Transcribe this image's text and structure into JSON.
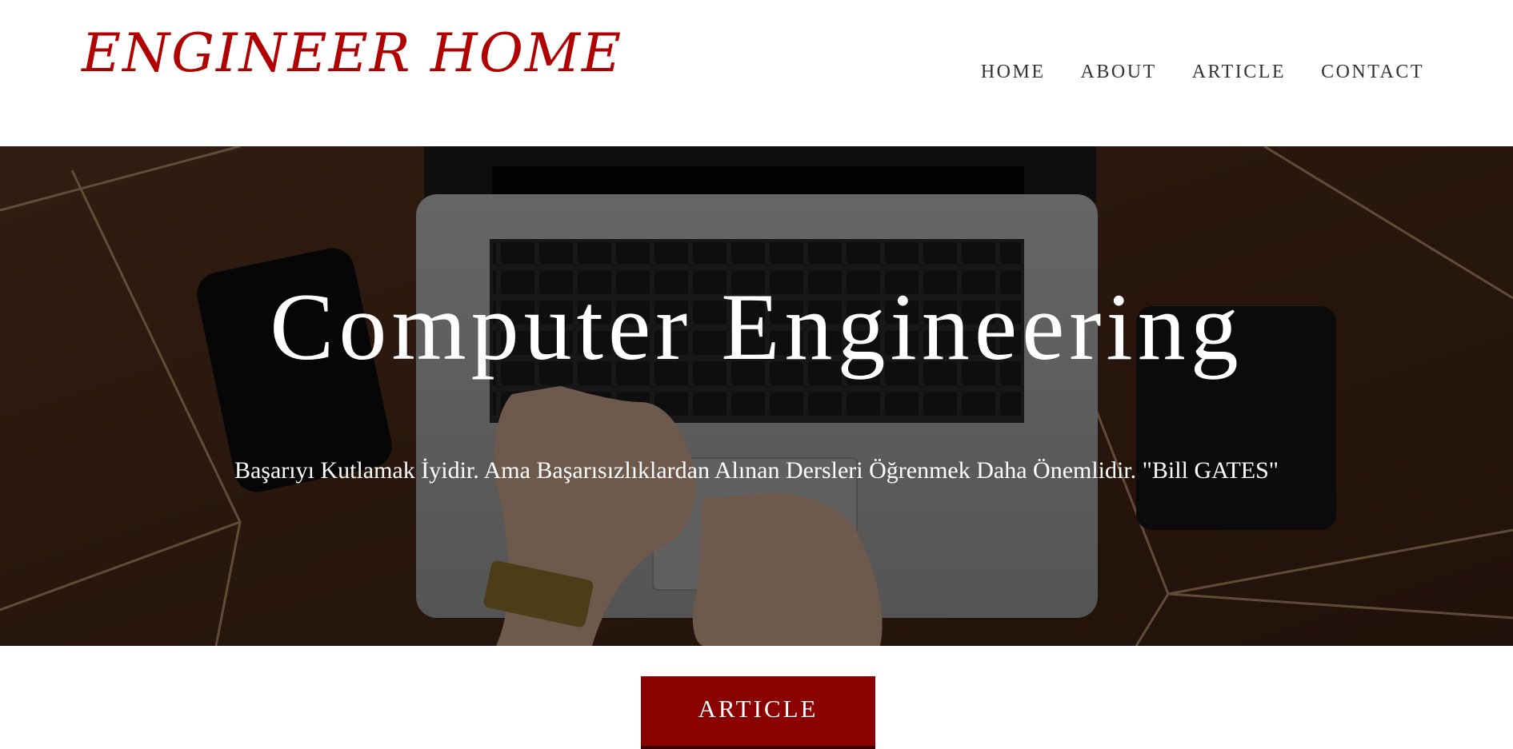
{
  "header": {
    "logo_text": "ENGINEER HOME",
    "nav": {
      "home": "HOME",
      "about": "ABOUT",
      "article": "ARTICLE",
      "contact": "CONTACT"
    }
  },
  "hero": {
    "title": "Computer Engineering",
    "quote": "Başarıyı Kutlamak İyidir. Ama Başarısızlıklardan Alınan Dersleri Öğrenmek Daha Önemlidir. \"Bill GATES\""
  },
  "cta": {
    "label": "ARTICLE"
  },
  "colors": {
    "logo": "#b00000",
    "cta_background": "#8b0000",
    "nav_text": "#333333",
    "hero_text": "#ffffff"
  }
}
